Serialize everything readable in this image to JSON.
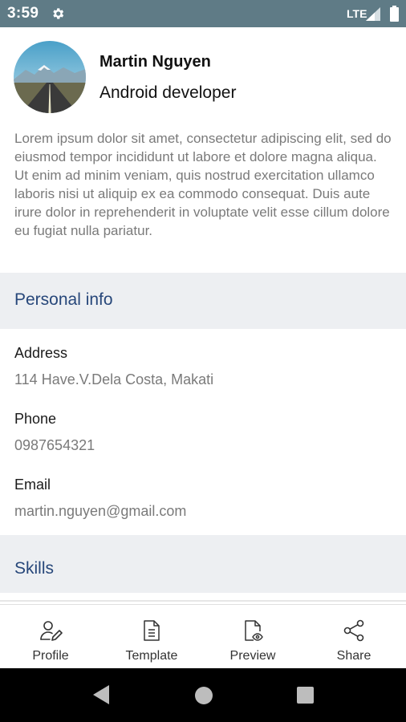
{
  "status_bar": {
    "time": "3:59",
    "network": "LTE",
    "icons": [
      "gear-icon",
      "signal-icon",
      "battery-icon"
    ],
    "background": "#5f7b86"
  },
  "profile": {
    "name": "Martin Nguyen",
    "role": "Android developer",
    "bio": "Lorem ipsum dolor sit amet, consectetur adipiscing elit, sed do eiusmod tempor incididunt ut labore et dolore magna aliqua. Ut enim ad minim veniam, quis nostrud exercitation ullamco laboris nisi ut aliquip ex ea commodo consequat. Duis aute irure dolor in reprehenderit in voluptate velit esse cillum dolore eu fugiat nulla pariatur."
  },
  "personal_info": {
    "title": "Personal info",
    "fields": [
      {
        "label": "Address",
        "value": "114 Have.V.Dela Costa, Makati"
      },
      {
        "label": "Phone",
        "value": "0987654321"
      },
      {
        "label": "Email",
        "value": "martin.nguyen@gmail.com"
      }
    ]
  },
  "skills": {
    "title": "Skills"
  },
  "bottom_nav": {
    "items": [
      {
        "label": "Profile",
        "icon": "profile-icon"
      },
      {
        "label": "Template",
        "icon": "template-icon"
      },
      {
        "label": "Preview",
        "icon": "preview-icon"
      },
      {
        "label": "Share",
        "icon": "share-icon"
      }
    ]
  },
  "system_nav": {
    "icons": [
      "back-icon",
      "home-icon",
      "recent-apps-icon"
    ]
  },
  "colors": {
    "section_background": "#edeff2",
    "section_title": "#27477a",
    "secondary_text": "#7a7a7a"
  }
}
